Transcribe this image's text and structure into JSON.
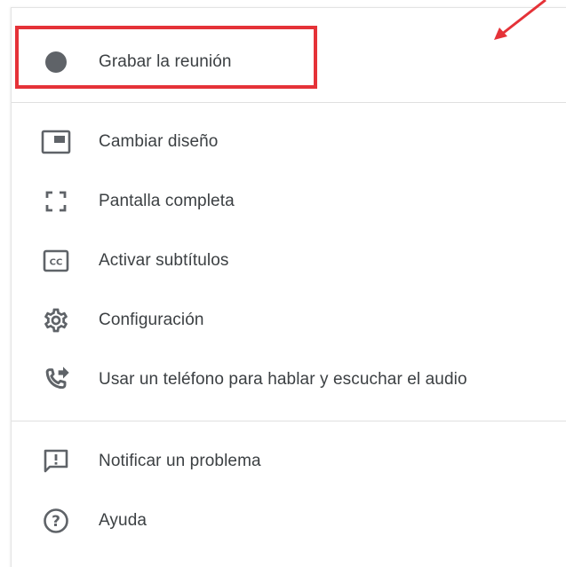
{
  "menu": {
    "items": [
      {
        "label": "Grabar la reunión",
        "icon": "record-dot-icon"
      },
      {
        "label": "Cambiar diseño",
        "icon": "layout-icon"
      },
      {
        "label": "Pantalla completa",
        "icon": "fullscreen-icon"
      },
      {
        "label": "Activar subtítulos",
        "icon": "closed-captions-icon"
      },
      {
        "label": "Configuración",
        "icon": "gear-icon"
      },
      {
        "label": "Usar un teléfono para hablar y escuchar el audio",
        "icon": "phone-forward-icon"
      },
      {
        "label": "Notificar un problema",
        "icon": "feedback-icon"
      },
      {
        "label": "Ayuda",
        "icon": "help-icon"
      }
    ]
  },
  "colors": {
    "highlight": "#e53238",
    "icon": "#5f6368",
    "text": "#3c4043",
    "divider": "#e0e0e0"
  }
}
